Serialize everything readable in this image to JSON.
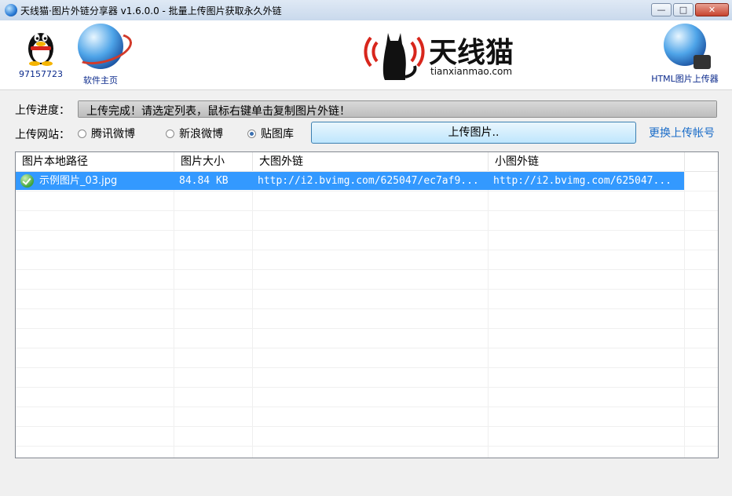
{
  "window": {
    "title": "天线猫·图片外链分享器 v1.6.0.0 - 批量上传图片获取永久外链",
    "min_symbol": "—",
    "max_symbol": "□",
    "close_symbol": "✕"
  },
  "header": {
    "qq_label": "97157723",
    "home_label": "软件主页",
    "html_uploader_label": "HTML图片上传器",
    "logo_title": "天线猫",
    "logo_sub": "tianxianmao.com"
  },
  "progress": {
    "label": "上传进度：",
    "value": 1.0,
    "text": "上传完成！请选定列表，鼠标右键单击复制图片外链！"
  },
  "site": {
    "label": "上传网站：",
    "options": [
      "腾讯微博",
      "新浪微博",
      "贴图库"
    ],
    "selected": "贴图库",
    "upload_button": "上传图片..",
    "switch_account": "更换上传帐号"
  },
  "table": {
    "columns": [
      "图片本地路径",
      "图片大小",
      "大图外链",
      "小图外链"
    ],
    "rows": [
      [
        "示例图片_03.jpg",
        "84.84 KB",
        "http://i2.bvimg.com/625047/ec7af9...",
        "http://i2.bvimg.com/625047..."
      ]
    ]
  }
}
